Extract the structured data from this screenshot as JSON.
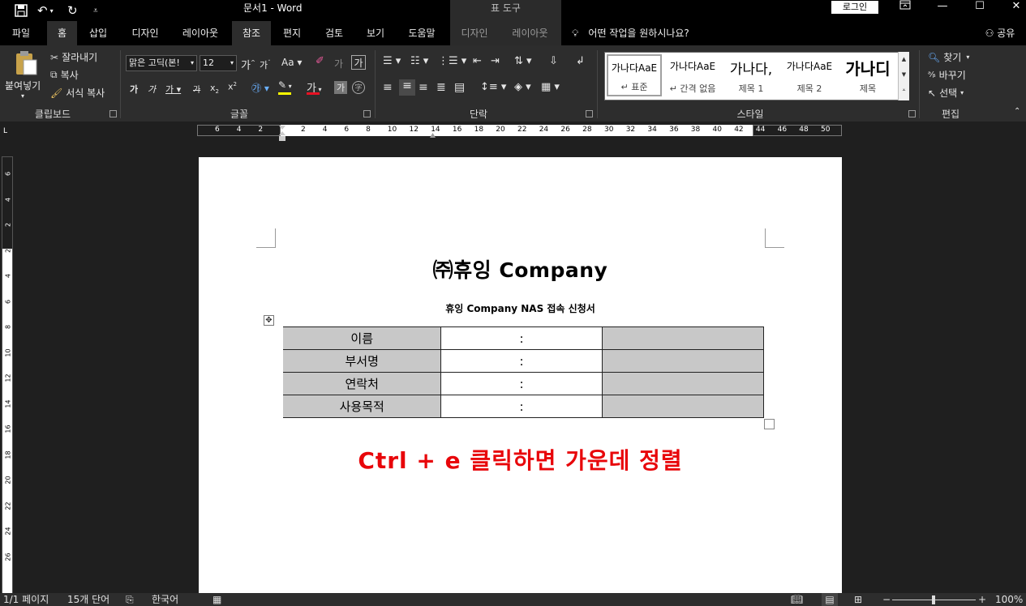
{
  "window": {
    "title": "문서1  -  Word",
    "context_tab_group": "표 도구",
    "login_button": "로그인"
  },
  "tabs": {
    "file": "파일",
    "home": "홈",
    "insert": "삽입",
    "design": "디자인",
    "layout": "레이아웃",
    "references": "참조",
    "mailings": "편지",
    "review": "검토",
    "view": "보기",
    "help": "도움말",
    "table_design": "디자인",
    "table_layout": "레이아웃",
    "tell_me": "어떤 작업을 원하시나요?",
    "share": "공유"
  },
  "ribbon": {
    "clipboard": {
      "paste": "붙여넣기",
      "cut": "잘라내기",
      "copy": "복사",
      "format_painter": "서식 복사",
      "label": "클립보드"
    },
    "font": {
      "font_name": "맑은 고딕(본!",
      "font_size": "12",
      "label": "글꼴",
      "font_color": "#e81123",
      "highlight_color": "#ffff00"
    },
    "paragraph": {
      "label": "단락"
    },
    "styles": {
      "label": "스타일",
      "items": [
        {
          "preview": "가나다AaE",
          "name": "↵ 표준"
        },
        {
          "preview": "가나다AaE",
          "name": "↵ 간격 없음"
        },
        {
          "preview": "가나다,",
          "name": "제목 1"
        },
        {
          "preview": "가나다AaE",
          "name": "제목 2"
        },
        {
          "preview": "가나디",
          "name": "제목"
        }
      ]
    },
    "editing": {
      "find": "찾기",
      "replace": "바꾸기",
      "select": "선택",
      "label": "편집"
    }
  },
  "ruler": {
    "h_left_numbers": [
      "6",
      "4",
      "2"
    ],
    "h_numbers": [
      "2",
      "4",
      "6",
      "8",
      "10",
      "12",
      "14",
      "16",
      "18",
      "20",
      "22",
      "24",
      "26",
      "28"
    ],
    "h_right_numbers": [
      "30",
      "32",
      "34",
      "36",
      "38",
      "40",
      "42",
      "44",
      "46",
      "48",
      "50"
    ],
    "v_numbers": [
      "6",
      "4",
      "2",
      "2",
      "4",
      "6",
      "8",
      "10",
      "12",
      "14",
      "16",
      "18",
      "20",
      "22",
      "24",
      "26"
    ]
  },
  "document": {
    "title": "㈜휴잉  Company",
    "subtitle": "휴잉  Company NAS  접속  신청서",
    "table_rows": [
      {
        "label": "이름",
        "sep": ":"
      },
      {
        "label": "부서명",
        "sep": ":"
      },
      {
        "label": "연락처",
        "sep": ":"
      },
      {
        "label": "사용목적",
        "sep": ":"
      }
    ],
    "annotation": "Ctrl + e 클릭하면 가운데 정렬"
  },
  "statusbar": {
    "page": "1/1 페이지",
    "words": "15개 단어",
    "language": "한국어",
    "zoom": "100%"
  }
}
